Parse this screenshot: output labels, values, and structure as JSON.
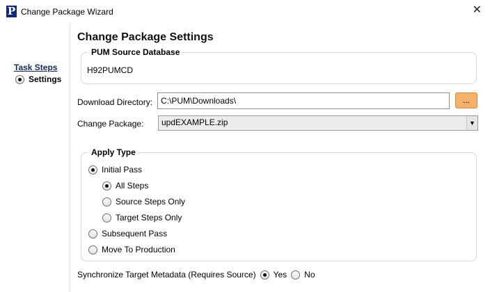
{
  "window": {
    "title": "Change Package Wizard",
    "app_icon_letter": "P",
    "close_glyph": "✕"
  },
  "task_panel": {
    "heading": "Task Steps",
    "steps": [
      {
        "label": "Settings",
        "selected": true
      }
    ]
  },
  "page": {
    "title": "Change Package Settings"
  },
  "pum_source": {
    "legend": "PUM Source Database",
    "value": "H92PUMCD"
  },
  "download": {
    "label": "Download Directory:",
    "value": "C:\\PUM\\Downloads\\",
    "browse_label": "..."
  },
  "change_package": {
    "label": "Change Package:",
    "value": "updEXAMPLE.zip"
  },
  "apply_type": {
    "legend": "Apply Type",
    "initial_pass": "Initial Pass",
    "all_steps": "All Steps",
    "source_steps_only": "Source Steps Only",
    "target_steps_only": "Target Steps Only",
    "subsequent_pass": "Subsequent Pass",
    "move_to_production": "Move To Production"
  },
  "sync": {
    "label": "Synchronize Target Metadata (Requires Source)",
    "yes": "Yes",
    "no": "No",
    "selected": "Yes"
  }
}
